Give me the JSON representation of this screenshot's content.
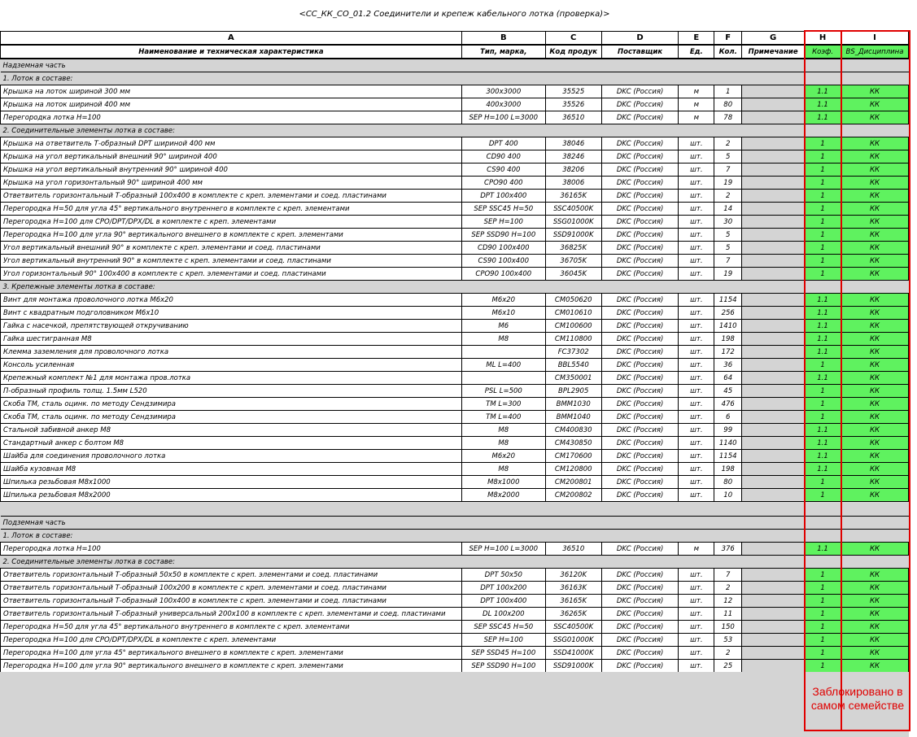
{
  "title": "<СС_КК_СО_01.2 Соединители и крепеж кабельного лотка (проверка)>",
  "column_letters": [
    "A",
    "B",
    "C",
    "D",
    "E",
    "F",
    "G",
    "H",
    "I"
  ],
  "headers": [
    "Наименование и техническая характеристика",
    "Тип, марка,",
    "Код продук",
    "Поставщик",
    "Ед.",
    "Кол.",
    "Примечание",
    "Коэф.",
    "ВS_Дисциплина"
  ],
  "note": "Заблокировано в самом семействе",
  "colors": {
    "highlight": "#5ff25f",
    "red": "#e00000",
    "grey": "#d4d4d4"
  },
  "rows": [
    {
      "kind": "section",
      "text": "Надземная часть"
    },
    {
      "kind": "section",
      "text": "1. Лоток в составе:"
    },
    {
      "kind": "item",
      "cells": [
        "Крышка на лоток шириной 300 мм",
        "300х3000",
        "35525",
        "DKC (Россия)",
        "м",
        "1",
        "",
        "1.1",
        "КК"
      ]
    },
    {
      "kind": "item",
      "cells": [
        "Крышка на лоток шириной 400 мм",
        "400х3000",
        "35526",
        "DKC (Россия)",
        "м",
        "80",
        "",
        "1.1",
        "КК"
      ]
    },
    {
      "kind": "item",
      "cells": [
        "Перегородка лотка Н=100",
        "SEP H=100 L=3000",
        "36510",
        "DKC (Россия)",
        "м",
        "78",
        "",
        "1.1",
        "КК"
      ]
    },
    {
      "kind": "section",
      "text": "2. Соединительные элементы лотка в составе:"
    },
    {
      "kind": "item",
      "cells": [
        "Крышка на ответвитель Т-образный DPT шириной 400 мм",
        "DPT 400",
        "38046",
        "DKC (Россия)",
        "шт.",
        "2",
        "",
        "1",
        "КК"
      ]
    },
    {
      "kind": "item",
      "cells": [
        "Крышка на угол вертикальный внешний 90° шириной 400",
        "CD90 400",
        "38246",
        "DKC (Россия)",
        "шт.",
        "5",
        "",
        "1",
        "КК"
      ]
    },
    {
      "kind": "item",
      "cells": [
        "Крышка на угол вертикальный внутренний 90° шириной 400",
        "CS90 400",
        "38206",
        "DKC (Россия)",
        "шт.",
        "7",
        "",
        "1",
        "КК"
      ]
    },
    {
      "kind": "item",
      "cells": [
        "Крышка на угол горизонтальный 90° шириной 400 мм",
        "CPO90 400",
        "38006",
        "DKC (Россия)",
        "шт.",
        "19",
        "",
        "1",
        "КК"
      ]
    },
    {
      "kind": "item",
      "cells": [
        "Ответвитель горизонтальный Т-образный 100х400 в комплекте с креп. элементами и соед. пластинами",
        "DPT 100х400",
        "36165K",
        "DKC (Россия)",
        "шт.",
        "2",
        "",
        "1",
        "КК"
      ]
    },
    {
      "kind": "item",
      "cells": [
        "Перегородка Н=50 для угла 45° вертикального внутреннего в комплекте с креп. элементами",
        "SEP SSC45 H=50",
        "SSC40500K",
        "DKC (Россия)",
        "шт.",
        "14",
        "",
        "1",
        "КК"
      ]
    },
    {
      "kind": "item",
      "cells": [
        "Перегородка Н=100 для CPO/DPT/DPX/DL в комплекте с креп. элементами",
        "SEP H=100",
        "SSG01000K",
        "DKC (Россия)",
        "шт.",
        "30",
        "",
        "1",
        "КК"
      ]
    },
    {
      "kind": "item",
      "cells": [
        "Перегородка Н=100 для угла 90° вертикального внешнего в комплекте с креп. элементами",
        "SEP SSD90 H=100",
        "SSD91000K",
        "DKC (Россия)",
        "шт.",
        "5",
        "",
        "1",
        "КК"
      ]
    },
    {
      "kind": "item",
      "cells": [
        "Угол вертикальный внешний 90° в комплекте с креп. элементами и соед. пластинами",
        "CD90 100х400",
        "36825K",
        "DKC (Россия)",
        "шт.",
        "5",
        "",
        "1",
        "КК"
      ]
    },
    {
      "kind": "item",
      "cells": [
        "Угол вертикальный внутренний 90° в комплекте с креп. элементами и соед. пластинами",
        "CS90 100х400",
        "36705K",
        "DKC (Россия)",
        "шт.",
        "7",
        "",
        "1",
        "КК"
      ]
    },
    {
      "kind": "item",
      "cells": [
        "Угол горизонтальный 90° 100х400 в комплекте с креп. элементами и соед. пластинами",
        "CPO90 100х400",
        "36045K",
        "DKC (Россия)",
        "шт.",
        "19",
        "",
        "1",
        "КК"
      ]
    },
    {
      "kind": "section",
      "text": "3. Крепежные элементы лотка в составе:"
    },
    {
      "kind": "item",
      "cells": [
        "Винт для монтажа проволочного лотка М6х20",
        "M6х20",
        "CM050620",
        "DKC (Россия)",
        "шт.",
        "1154",
        "",
        "1.1",
        "КК"
      ]
    },
    {
      "kind": "item",
      "cells": [
        "Винт с квадратным подголовником М6х10",
        "M6х10",
        "CM010610",
        "DKC (Россия)",
        "шт.",
        "256",
        "",
        "1.1",
        "КК"
      ]
    },
    {
      "kind": "item",
      "cells": [
        "Гайка с насечкой, препятствующей откручиванию",
        "M6",
        "CM100600",
        "DKC (Россия)",
        "шт.",
        "1410",
        "",
        "1.1",
        "КК"
      ]
    },
    {
      "kind": "item",
      "cells": [
        "Гайка шестигранная М8",
        "M8",
        "CM110800",
        "DKC (Россия)",
        "шт.",
        "198",
        "",
        "1.1",
        "КК"
      ]
    },
    {
      "kind": "item",
      "cells": [
        "Клемма заземления для проволочного лотка",
        "",
        "FC37302",
        "DKC (Россия)",
        "шт.",
        "172",
        "",
        "1.1",
        "КК"
      ]
    },
    {
      "kind": "item",
      "cells": [
        "Консоль усиленная",
        "ML L=400",
        "BBL5540",
        "DKC (Россия)",
        "шт.",
        "36",
        "",
        "1",
        "КК"
      ]
    },
    {
      "kind": "item",
      "cells": [
        "Крепежный комплект №1 для монтажа пров.лотка",
        "",
        "CM350001",
        "DKC (Россия)",
        "шт.",
        "64",
        "",
        "1.1",
        "КК"
      ]
    },
    {
      "kind": "item",
      "cells": [
        "П-образный профиль толщ. 1.5мм L520",
        "PSL L=500",
        "BPL2905",
        "DKC (Россия)",
        "шт.",
        "45",
        "",
        "1",
        "КК"
      ]
    },
    {
      "kind": "item",
      "cells": [
        "Скоба ТМ, сталь оцинк. по методу Сендзимира",
        "TM L=300",
        "BMM1030",
        "DKC (Россия)",
        "шт.",
        "476",
        "",
        "1",
        "КК"
      ]
    },
    {
      "kind": "item",
      "cells": [
        "Скоба ТМ, сталь оцинк. по методу Сендзимира",
        "TM L=400",
        "BMM1040",
        "DKC (Россия)",
        "шт.",
        "6",
        "",
        "1",
        "КК"
      ]
    },
    {
      "kind": "item",
      "cells": [
        "Стальной забивной анкер М8",
        "M8",
        "CM400830",
        "DKC (Россия)",
        "шт.",
        "99",
        "",
        "1.1",
        "КК"
      ]
    },
    {
      "kind": "item",
      "cells": [
        "Стандартный анкер с болтом М8",
        "M8",
        "CM430850",
        "DKC (Россия)",
        "шт.",
        "1140",
        "",
        "1.1",
        "КК"
      ]
    },
    {
      "kind": "item",
      "cells": [
        "Шайба для соединения проволочного лотка",
        "M6х20",
        "CM170600",
        "DKC (Россия)",
        "шт.",
        "1154",
        "",
        "1.1",
        "КК"
      ]
    },
    {
      "kind": "item",
      "cells": [
        "Шайба кузовная М8",
        "M8",
        "CM120800",
        "DKC (Россия)",
        "шт.",
        "198",
        "",
        "1.1",
        "КК"
      ]
    },
    {
      "kind": "item",
      "cells": [
        "Шпилька резьбовая М8х1000",
        "M8х1000",
        "CM200801",
        "DKC (Россия)",
        "шт.",
        "80",
        "",
        "1",
        "КК"
      ]
    },
    {
      "kind": "item",
      "cells": [
        "Шпилька резьбовая М8х2000",
        "M8х2000",
        "CM200802",
        "DKC (Россия)",
        "шт.",
        "10",
        "",
        "1",
        "КК"
      ]
    },
    {
      "kind": "blank"
    },
    {
      "kind": "section",
      "text": "Подземная часть"
    },
    {
      "kind": "section",
      "text": "1. Лоток в составе:"
    },
    {
      "kind": "item",
      "cells": [
        "Перегородка лотка Н=100",
        "SEP H=100 L=3000",
        "36510",
        "DKC (Россия)",
        "м",
        "376",
        "",
        "1.1",
        "КК"
      ]
    },
    {
      "kind": "section",
      "text": "2. Соединительные элементы лотка в составе:"
    },
    {
      "kind": "item",
      "cells": [
        "Ответвитель горизонтальный Т-образный 50х50 в комплекте с креп. элементами и соед. пластинами",
        "DPT 50х50",
        "36120K",
        "DKC (Россия)",
        "шт.",
        "7",
        "",
        "1",
        "КК"
      ]
    },
    {
      "kind": "item",
      "cells": [
        "Ответвитель горизонтальный Т-образный 100х200 в комплекте с креп. элементами и соед. пластинами",
        "DPT 100х200",
        "36163K",
        "DKC (Россия)",
        "шт.",
        "2",
        "",
        "1",
        "КК"
      ]
    },
    {
      "kind": "item",
      "cells": [
        "Ответвитель горизонтальный Т-образный 100х400 в комплекте с креп. элементами и соед. пластинами",
        "DPT 100х400",
        "36165K",
        "DKC (Россия)",
        "шт.",
        "12",
        "",
        "1",
        "КК"
      ]
    },
    {
      "kind": "item",
      "cells": [
        "Ответвитель горизонтальный Т-образный универсальный 200х100 в комплекте с креп. элементами и соед. пластинами",
        "DL 100х200",
        "36265K",
        "DKC (Россия)",
        "шт.",
        "11",
        "",
        "1",
        "КК"
      ]
    },
    {
      "kind": "item",
      "cells": [
        "Перегородка Н=50 для угла 45° вертикального внутреннего в комплекте с креп. элементами",
        "SEP SSC45 H=50",
        "SSC40500K",
        "DKC (Россия)",
        "шт.",
        "150",
        "",
        "1",
        "КК"
      ]
    },
    {
      "kind": "item",
      "cells": [
        "Перегородка Н=100 для CPO/DPT/DPX/DL в комплекте с креп. элементами",
        "SEP H=100",
        "SSG01000K",
        "DKC (Россия)",
        "шт.",
        "53",
        "",
        "1",
        "КК"
      ]
    },
    {
      "kind": "item",
      "cells": [
        "Перегородка Н=100 для угла 45° вертикального внешнего в комплекте с креп. элементами",
        "SEP SSD45 H=100",
        "SSD41000K",
        "DKC (Россия)",
        "шт.",
        "2",
        "",
        "1",
        "КК"
      ]
    },
    {
      "kind": "item",
      "cells": [
        "Перегородка Н=100 для угла 90° вертикального внешнего в комплекте с креп. элементами",
        "SEP SSD90 H=100",
        "SSD91000K",
        "DKC (Россия)",
        "шт.",
        "25",
        "",
        "1",
        "КК"
      ]
    }
  ]
}
